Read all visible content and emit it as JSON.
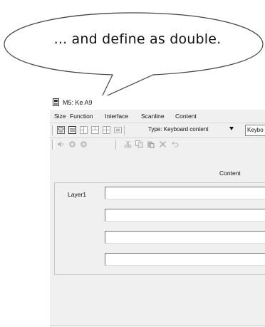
{
  "callout": {
    "text": "... and define as double."
  },
  "window": {
    "title": "M5: Ke  A9"
  },
  "menu": [
    "Size",
    "Function",
    "Interface",
    "Scanline",
    "Content"
  ],
  "toolbar": {
    "type_select": "Type: Keyboard content",
    "keyboard_combo": "Keybo"
  },
  "content": {
    "column_header": "Content",
    "layer_label": "Layer1"
  }
}
